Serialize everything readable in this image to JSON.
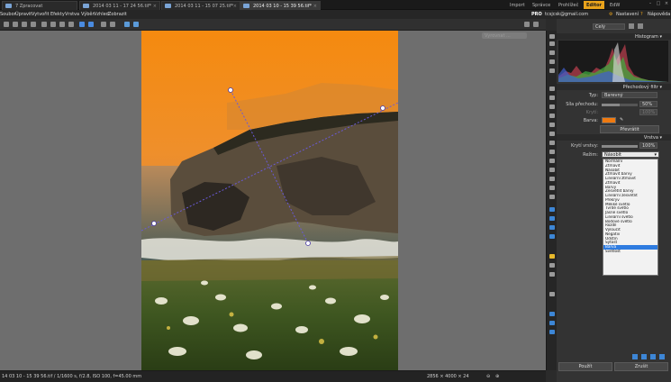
{
  "tabs": [
    {
      "label": "7 Zpracovat"
    },
    {
      "label": "2014 03 11 - 17 24 56.tif*"
    },
    {
      "label": "2014 03 11 - 15 07 25.tif*"
    },
    {
      "label": "2014 03 10 - 15 39 56.tif*"
    }
  ],
  "modes": [
    "Import",
    "Správce",
    "Prohlížeč",
    "Editor",
    "EdW"
  ],
  "menu": [
    "Soubor",
    "Úpravit",
    "Vytvořit",
    "Efekty",
    "Vrstva",
    "Výběr",
    "Vzhled",
    "Zobrazit"
  ],
  "account": {
    "pro_label": "PRO",
    "email": "tcsjcsk@gmail.com",
    "settings_label": "Nastavení",
    "help_label": "Nápověda"
  },
  "canvas": {
    "hidden_pill": "Vyrovnat ..."
  },
  "statusbar": {
    "left_text": "14 03 10 - 15 39 56.tif / 1/1600 s, f/2.8, ISO 100, f=45.00 mm",
    "size_text": "2856 × 4000 × 24"
  },
  "panel": {
    "zoom_label": "Celý",
    "histogram_title": "Histogram",
    "gradient_title": "Přechodový filtr",
    "typ_label": "Typ:",
    "typ_value": "Barevný",
    "strength_label": "Síla přechodu:",
    "strength_value": "50%",
    "opacity_label": "Krytí:",
    "opacity_value": "100%",
    "color_label": "Barva:",
    "color_value": "#f07a10",
    "invert_button": "Převrátit",
    "layer_title": "Vrstva",
    "layer_opacity_label": "Krytí vrstvy:",
    "layer_opacity_value": "100%",
    "blend_label": "Režim:",
    "blend_value": "Násobit",
    "apply_button": "Použít",
    "cancel_button": "Zrušit"
  },
  "blend_modes": [
    "Normální",
    "Ztmavit",
    "Násobit",
    "Ztmavit barvy",
    "Lineární ztmavit",
    "Ztmavit",
    "Barvy",
    "Zesvětlit barvy",
    "Lineární zesvětlit",
    "Překryv",
    "Měkké světlo",
    "Tvrdé světlo",
    "Jasné světlo",
    "Lineární světlo",
    "Bodové světlo",
    "Rozdíl",
    "Vyloučit",
    "Negativ",
    "Odstín",
    "Sytost",
    "Barva",
    "Světlost"
  ],
  "blend_selected_index": 20
}
